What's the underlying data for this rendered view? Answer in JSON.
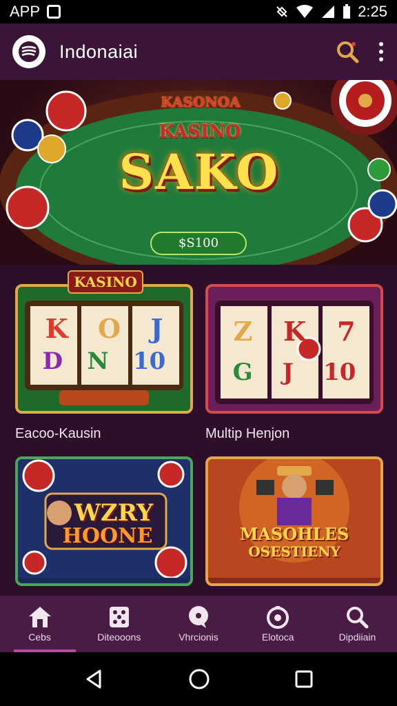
{
  "status_bar": {
    "app_label": "APP",
    "time": "2:25"
  },
  "app_bar": {
    "title": "Indonaiai"
  },
  "hero": {
    "badge_text": "KASONOA",
    "sub_text": "KASINO",
    "main_text": "SAKO",
    "button_label": "$S100"
  },
  "cards": [
    {
      "caption": "Eacoo-Kausin",
      "banner": "KASINO",
      "reels": [
        "K",
        "O",
        "J",
        "D",
        "N",
        "10"
      ]
    },
    {
      "caption": "Multip Henjon",
      "reels": [
        "Z",
        "K",
        "7",
        "G",
        "J",
        "10"
      ]
    },
    {
      "caption": "",
      "title_line1": "WZRY",
      "title_line2": "HOONE"
    },
    {
      "caption": "",
      "title_line1": "MASOHLES",
      "title_line2": "OSESTIENY"
    }
  ],
  "bottom_nav": {
    "items": [
      {
        "label": "Cebs",
        "icon": "home-icon"
      },
      {
        "label": "Diteooons",
        "icon": "dice-icon"
      },
      {
        "label": "Vhrcionis",
        "icon": "chat-icon"
      },
      {
        "label": "Elotoca",
        "icon": "target-icon"
      },
      {
        "label": "Dipdiiain",
        "icon": "search-icon"
      }
    ]
  },
  "colors": {
    "app_bar": "#3b1537",
    "background": "#2a0f26",
    "nav": "#4a1b44",
    "accent_gold": "#e2a84a"
  }
}
